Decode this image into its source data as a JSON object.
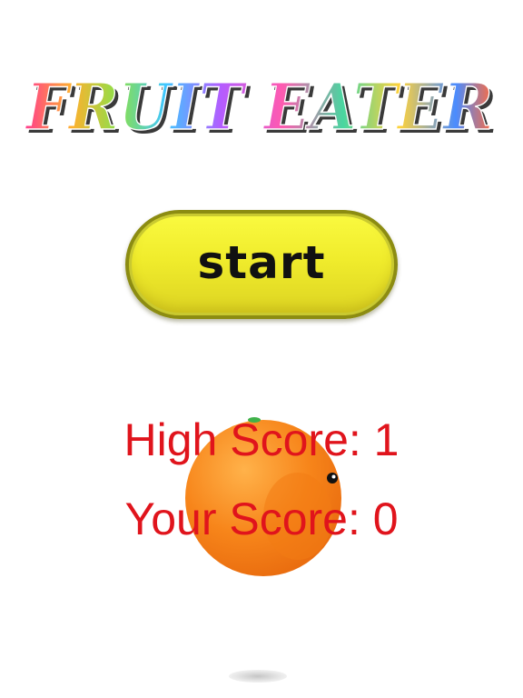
{
  "title": {
    "text": "FRUIT EATER",
    "gradient_colors": [
      "#ff3b8e",
      "#ffb02e",
      "#8be04a",
      "#3fc7ff",
      "#b45cff",
      "#ff5ab0",
      "#48d6a0",
      "#ffd23a",
      "#4a8cff"
    ]
  },
  "start_button": {
    "label": "start",
    "fill": "#f0ec2c",
    "border": "#8c8c12"
  },
  "scores": {
    "high_score_label": "High Score: 1",
    "your_score_label": "Your Score: 0",
    "color": "#e0141c"
  },
  "mascot": {
    "icon": "orange-fruit-icon",
    "color": "#f57f16",
    "leaf_color": "#3fb24a"
  }
}
